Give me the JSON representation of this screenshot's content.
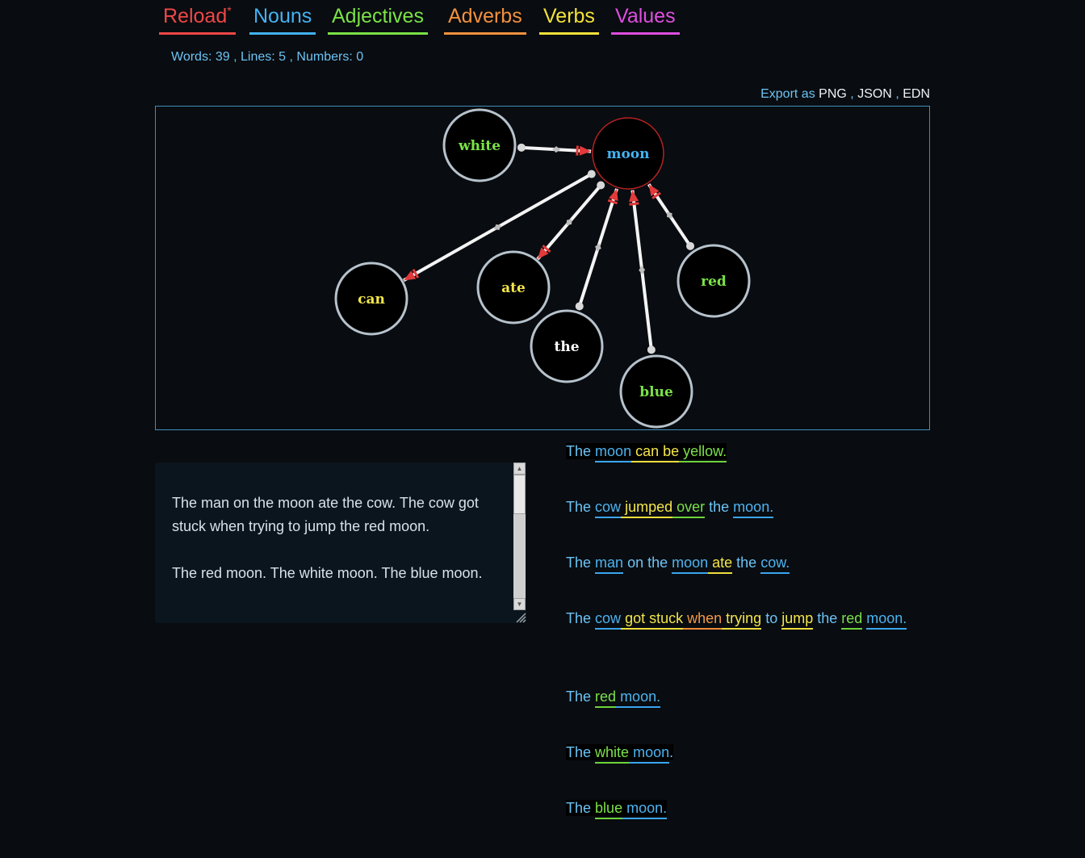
{
  "tabs": [
    {
      "label": "Reload",
      "marker": "*",
      "color": "#ef4747"
    },
    {
      "label": "Nouns",
      "color": "#43b3f2"
    },
    {
      "label": "Adjectives",
      "color": "#7ae246"
    },
    {
      "label": "Adverbs",
      "color": "#f2913d"
    },
    {
      "label": "Verbs",
      "color": "#f3e23a"
    },
    {
      "label": "Values",
      "color": "#de4ee0"
    }
  ],
  "stats": {
    "words_label": "Words:",
    "words": "39",
    "lines_label": "Lines:",
    "lines": "5",
    "numbers_label": "Numbers:",
    "numbers": "0",
    "sep": ","
  },
  "export": {
    "label": "Export as",
    "png": "PNG",
    "json": "JSON",
    "edn": "EDN",
    "sep": ","
  },
  "graph": {
    "nodes": [
      {
        "id": "white",
        "label": "white",
        "color": "#7ae246",
        "type": "adjective"
      },
      {
        "id": "moon",
        "label": "moon",
        "color": "#43b3f2",
        "type": "noun",
        "selected": true
      },
      {
        "id": "can",
        "label": "can",
        "color": "#f3e64a",
        "type": "verb"
      },
      {
        "id": "ate",
        "label": "ate",
        "color": "#f3e64a",
        "type": "verb"
      },
      {
        "id": "the",
        "label": "the",
        "color": "#ffffff",
        "type": "other"
      },
      {
        "id": "blue",
        "label": "blue",
        "color": "#7ae246",
        "type": "adjective"
      },
      {
        "id": "red",
        "label": "red",
        "color": "#7ae246",
        "type": "adjective"
      }
    ],
    "links": [
      {
        "source": "white",
        "target": "moon"
      },
      {
        "source": "moon",
        "target": "can"
      },
      {
        "source": "moon",
        "target": "ate"
      },
      {
        "source": "the",
        "target": "moon"
      },
      {
        "source": "blue",
        "target": "moon"
      },
      {
        "source": "red",
        "target": "moon"
      }
    ]
  },
  "editor": {
    "paragraphs": [
      "The man on the moon ate the cow. The cow got stuck when trying to jump the red moon.",
      "The red moon. The white moon. The blue moon."
    ]
  },
  "sentences": [
    {
      "tokens": [
        {
          "t": "The",
          "k": "p"
        },
        {
          "t": " ",
          "k": "s"
        },
        {
          "t": "moon",
          "k": "n"
        },
        {
          "t": " can be",
          "k": "v"
        },
        {
          "t": " yellow.",
          "k": "a"
        }
      ],
      "highlight": true
    },
    {
      "tokens": [
        {
          "t": "The",
          "k": "p"
        },
        {
          "t": " ",
          "k": "s"
        },
        {
          "t": "cow",
          "k": "n"
        },
        {
          "t": " jumped",
          "k": "v"
        },
        {
          "t": " over",
          "k": "a"
        },
        {
          "t": " the ",
          "k": "p"
        },
        {
          "t": "moon.",
          "k": "n"
        }
      ]
    },
    {
      "tokens": [
        {
          "t": "The",
          "k": "p"
        },
        {
          "t": " ",
          "k": "s"
        },
        {
          "t": "man",
          "k": "n"
        },
        {
          "t": " on the ",
          "k": "p"
        },
        {
          "t": "moon",
          "k": "n"
        },
        {
          "t": " ate",
          "k": "v"
        },
        {
          "t": " the ",
          "k": "p"
        },
        {
          "t": "cow.",
          "k": "n"
        }
      ]
    },
    {
      "tokens": [
        {
          "t": "The",
          "k": "p"
        },
        {
          "t": " ",
          "k": "s"
        },
        {
          "t": "cow",
          "k": "n"
        },
        {
          "t": " got stuck",
          "k": "v"
        },
        {
          "t": " when",
          "k": "d"
        },
        {
          "t": " trying",
          "k": "v"
        },
        {
          "t": " to ",
          "k": "p"
        },
        {
          "t": "jump",
          "k": "v"
        },
        {
          "t": " the ",
          "k": "p"
        },
        {
          "t": "red",
          "k": "a"
        },
        {
          "t": " ",
          "k": "s"
        },
        {
          "t": "moon.",
          "k": "n"
        }
      ]
    },
    {
      "tokens": [
        {
          "t": "The",
          "k": "p"
        },
        {
          "t": " ",
          "k": "s"
        },
        {
          "t": "red",
          "k": "a"
        },
        {
          "t": " moon.",
          "k": "n"
        }
      ]
    },
    {
      "tokens": [
        {
          "t": "The",
          "k": "p"
        },
        {
          "t": " ",
          "k": "s"
        },
        {
          "t": "white",
          "k": "a"
        },
        {
          "t": " moon",
          "k": "n"
        },
        {
          "t": ".",
          "k": "p"
        }
      ],
      "highlight": true
    },
    {
      "tokens": [
        {
          "t": "The",
          "k": "p"
        },
        {
          "t": " ",
          "k": "s"
        },
        {
          "t": "blue",
          "k": "a"
        },
        {
          "t": " moon.",
          "k": "n"
        }
      ],
      "highlight": true
    }
  ]
}
